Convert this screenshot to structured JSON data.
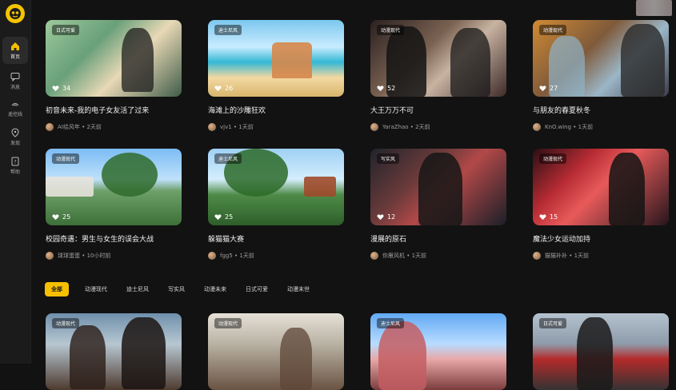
{
  "sidebar": {
    "items": [
      {
        "label": "首页",
        "icon": "home-icon"
      },
      {
        "label": "消息",
        "icon": "chat-icon"
      },
      {
        "label": "遥控线",
        "icon": "signal-icon"
      },
      {
        "label": "发现",
        "icon": "location-icon"
      },
      {
        "label": "帮助",
        "icon": "help-icon"
      }
    ]
  },
  "cards_row1": [
    {
      "tag": "日式可爱",
      "likes": "34",
      "title": "初音未来-我的电子女友活了过来",
      "author": "AI绘风年",
      "time": "2天前"
    },
    {
      "tag": "迪士尼风",
      "likes": "26",
      "title": "海滩上的沙雕狂欢",
      "author": "vjv1",
      "time": "1天前"
    },
    {
      "tag": "动漫现代",
      "likes": "52",
      "title": "大王万万不可",
      "author": "YaraZhao",
      "time": "2天前"
    },
    {
      "tag": "动漫现代",
      "likes": "27",
      "title": "与朋友的春夏秋冬",
      "author": "KnO.wing",
      "time": "1天前"
    }
  ],
  "cards_row2": [
    {
      "tag": "动漫现代",
      "likes": "25",
      "title": "校园奇遇：男生与女生的误会大战",
      "author": "球球蛋蛋",
      "time": "10小时前"
    },
    {
      "tag": "迪士尼风",
      "likes": "25",
      "title": "躲猫猫大赛",
      "author": "fgg5",
      "time": "1天前"
    },
    {
      "tag": "写实风",
      "likes": "12",
      "title": "漫展的原石",
      "author": "你雁风机",
      "time": "1天前"
    },
    {
      "tag": "动漫现代",
      "likes": "15",
      "title": "魔法少女运动加持",
      "author": "猫猫补补",
      "time": "1天前"
    }
  ],
  "filters": [
    "全部",
    "动漫现代",
    "迪士尼风",
    "写实风",
    "动漫未来",
    "日式可爱",
    "动漫末世"
  ],
  "cards_row3": [
    {
      "tag": "动漫现代"
    },
    {
      "tag": "动漫现代"
    },
    {
      "tag": "迪士尼风"
    },
    {
      "tag": "日式可爱"
    }
  ],
  "colors": {
    "accent": "#f6c000",
    "background": "#121212",
    "sidebar": "#1b1b1b"
  }
}
